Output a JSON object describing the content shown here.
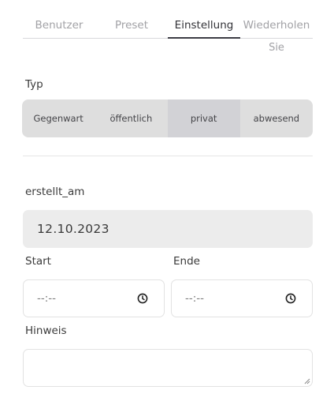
{
  "tabs": [
    {
      "label": "Benutzer",
      "active": false
    },
    {
      "label": "Preset",
      "active": false
    },
    {
      "label": "Einstellung",
      "active": true
    },
    {
      "label": "Wiederholen",
      "label_line2": "Sie",
      "active": false
    }
  ],
  "type_section": {
    "label": "Typ",
    "options": [
      "Gegenwart",
      "öffentlich",
      "privat",
      "abwesend"
    ],
    "selected": "privat"
  },
  "created_section": {
    "label": "erstellt_am",
    "value": "12.10.2023"
  },
  "start": {
    "label": "Start",
    "value": "--:--",
    "icon": "clock-icon"
  },
  "end": {
    "label": "Ende",
    "value": "--:--",
    "icon": "clock-icon"
  },
  "note": {
    "label": "Hinweis",
    "value": ""
  },
  "colors": {
    "active_tab_underline": "#3c3c44",
    "segmented_bg": "#dedede",
    "segmented_selected": "#d2d2d6",
    "readonly_field_bg": "#ececec"
  }
}
